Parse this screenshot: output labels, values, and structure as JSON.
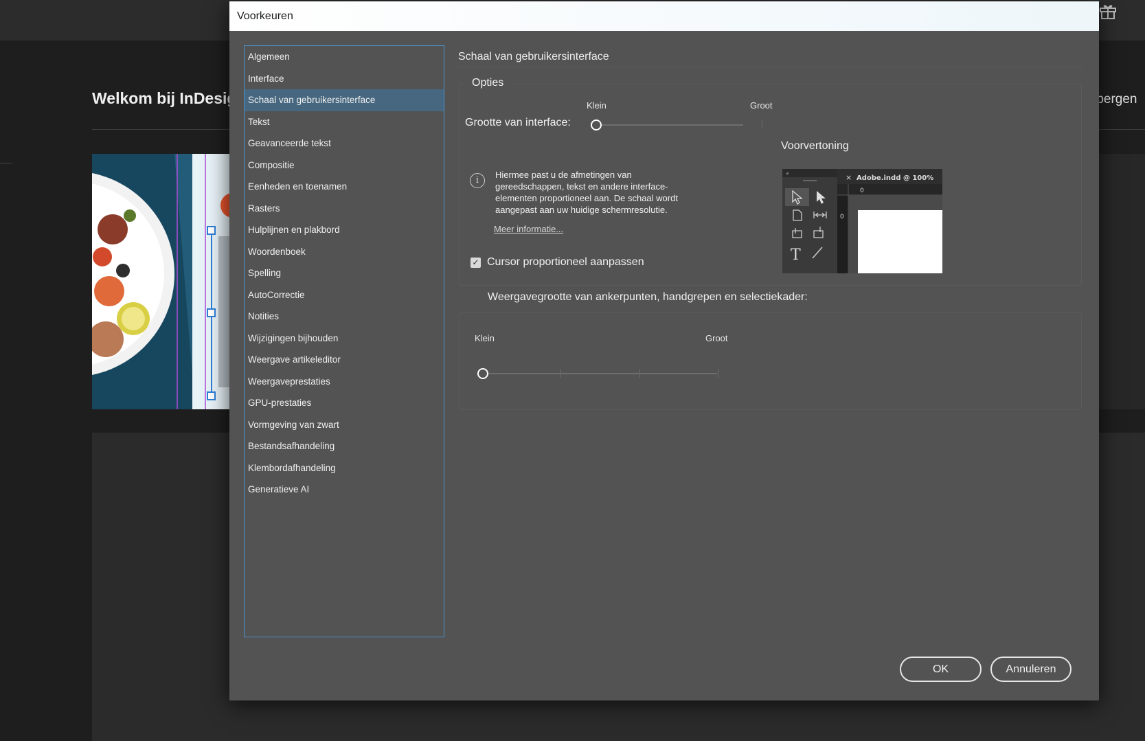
{
  "background": {
    "welcome_title": "Welkom bij InDesign",
    "right_partial_text": "rbergen"
  },
  "dialog": {
    "title": "Voorkeuren",
    "categories": [
      {
        "label": "Algemeen",
        "selected": false
      },
      {
        "label": "Interface",
        "selected": false
      },
      {
        "label": "Schaal van gebruikersinterface",
        "selected": true
      },
      {
        "label": "Tekst",
        "selected": false
      },
      {
        "label": "Geavanceerde tekst",
        "selected": false
      },
      {
        "label": "Compositie",
        "selected": false
      },
      {
        "label": "Eenheden en toenamen",
        "selected": false
      },
      {
        "label": "Rasters",
        "selected": false
      },
      {
        "label": "Hulplijnen en plakbord",
        "selected": false
      },
      {
        "label": "Woordenboek",
        "selected": false
      },
      {
        "label": "Spelling",
        "selected": false
      },
      {
        "label": "AutoCorrectie",
        "selected": false
      },
      {
        "label": "Notities",
        "selected": false
      },
      {
        "label": "Wijzigingen bijhouden",
        "selected": false
      },
      {
        "label": "Weergave artikeleditor",
        "selected": false
      },
      {
        "label": "Weergaveprestaties",
        "selected": false
      },
      {
        "label": "GPU-prestaties",
        "selected": false
      },
      {
        "label": "Vormgeving van zwart",
        "selected": false
      },
      {
        "label": "Bestandsafhandeling",
        "selected": false
      },
      {
        "label": "Klembordafhandeling",
        "selected": false
      },
      {
        "label": "Generatieve AI",
        "selected": false
      }
    ],
    "section_title": "Schaal van gebruikersinterface",
    "options": {
      "group_label": "Opties",
      "interface_size_label": "Grootte van interface:",
      "slider_min_label": "Klein",
      "slider_max_label": "Groot",
      "slider_value_fraction": 0.0,
      "info_text": "Hiermee past u de afmetingen van gereedschappen, tekst en andere interface-elementen proportioneel aan. De schaal wordt aangepast aan uw huidige schermresolutie.",
      "info_link": "Meer informatie...",
      "checkbox_label": "Cursor proportioneel aanpassen",
      "checkbox_checked": true,
      "preview_title": "Voorvertoning",
      "preview_tab_label": "Adobe.indd @ 100%",
      "preview_ruler_zero": "0"
    },
    "anchor": {
      "group_label": "Weergavegrootte van ankerpunten, handgrepen en selectiekader:",
      "slider_min_label": "Klein",
      "slider_max_label": "Groot",
      "slider_value_fraction": 0.0,
      "tick_count": 4
    },
    "buttons": {
      "ok": "OK",
      "cancel": "Annuleren"
    }
  },
  "colors": {
    "dialog_bg": "#535353",
    "selected_item": "#46677f",
    "list_border": "#4a90c8"
  }
}
